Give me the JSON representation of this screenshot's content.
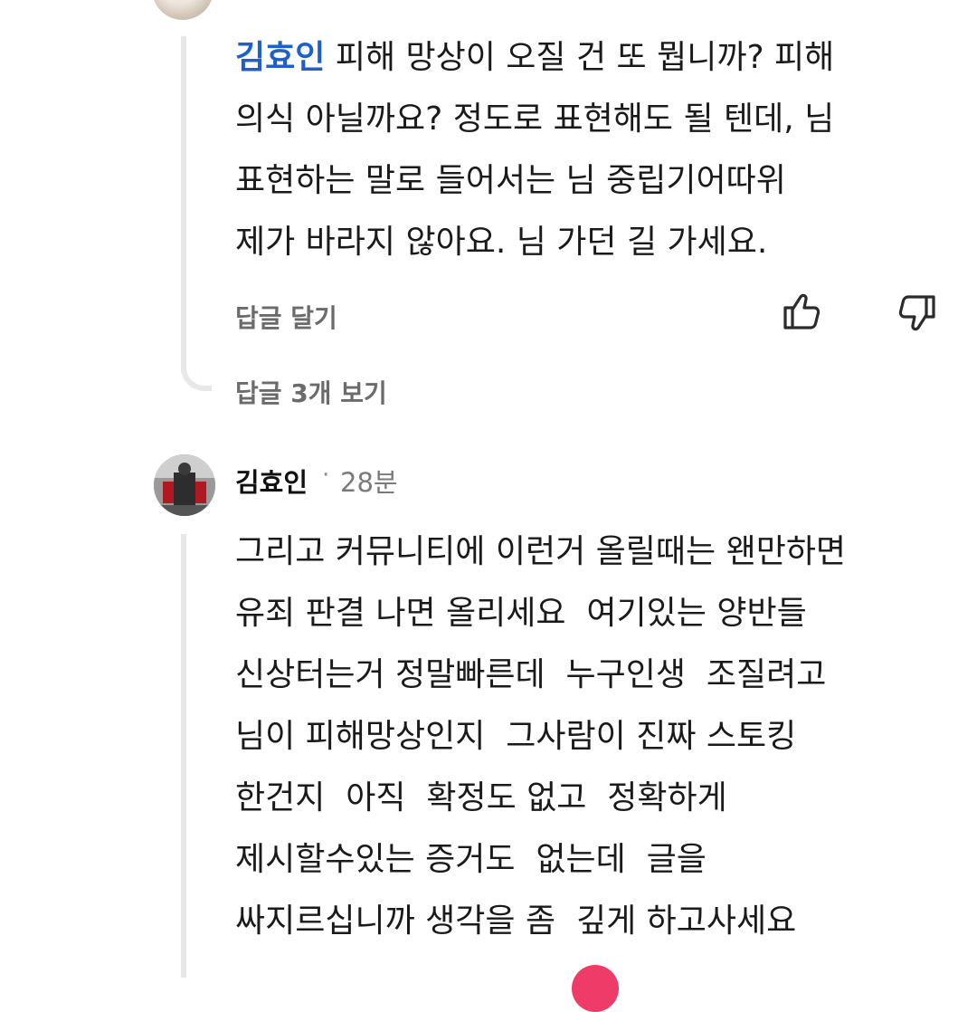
{
  "reply": {
    "mention": "김효인",
    "lines": [
      " 피해 망상이 오질 건 또 뭡니까? 피해",
      "의식 아닐까요? 정도로 표현해도 될 텐데, 님",
      "표현하는 말로 들어서는 님 중립기어따위",
      "제가 바라지 않아요. 님 가던 길 가세요."
    ],
    "reply_label": "답글 달기",
    "view_replies_label": "답글 3개 보기",
    "like_icon": "thumbs-up-icon",
    "dislike_icon": "thumbs-down-icon"
  },
  "comment": {
    "author": "김효인",
    "separator": "·",
    "time": "28분",
    "lines": [
      "그리고 커뮤니티에 이런거 올릴때는 왠만하면",
      "유죄 판결 나면 올리세요  여기있는 양반들",
      "신상터는거 정말빠른데  누구인생  조질려고",
      "님이 피해망상인지  그사람이 진짜 스토킹",
      "한건지  아직  확정도 없고  정확하게",
      "제시할수있는 증거도  없는데  글을",
      "싸지르십니까 생각을 좀  깊게 하고사세요"
    ]
  },
  "colors": {
    "mention": "#1f5fc8",
    "secondary_text": "#6b6b6b",
    "thread_line": "#e8e8e8"
  }
}
